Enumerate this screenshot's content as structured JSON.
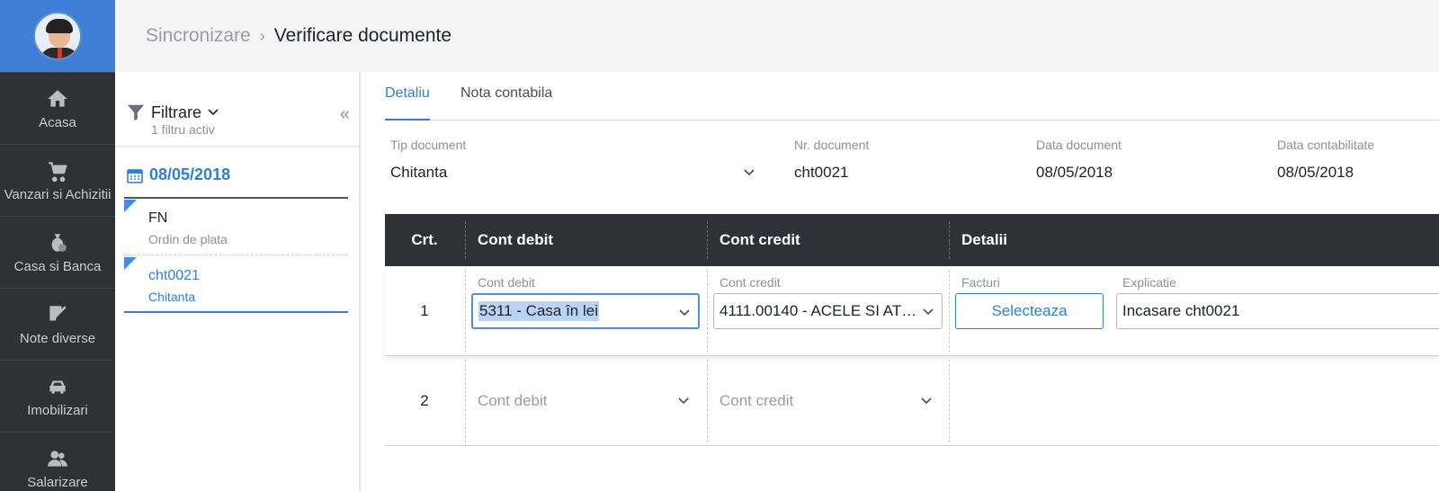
{
  "nav": {
    "items": [
      {
        "label": "Acasa",
        "icon": "home-icon"
      },
      {
        "label": "Vanzari si Achizitii",
        "icon": "cart-icon"
      },
      {
        "label": "Casa si Banca",
        "icon": "money-bag-icon"
      },
      {
        "label": "Note diverse",
        "icon": "note-check-icon"
      },
      {
        "label": "Imobilizari",
        "icon": "car-icon"
      },
      {
        "label": "Salarizare",
        "icon": "people-icon"
      }
    ]
  },
  "header": {
    "crumb_parent": "Sincronizare",
    "crumb_current": "Verificare documente"
  },
  "filter": {
    "title": "Filtrare",
    "subtitle": "1 filtru activ",
    "date": "08/05/2018",
    "documents": [
      {
        "number": "FN",
        "type": "Ordin de plata"
      },
      {
        "number": "cht0021",
        "type": "Chitanta"
      }
    ]
  },
  "tabs": [
    "Detaliu",
    "Nota contabila"
  ],
  "fields": {
    "tip_label": "Tip document",
    "tip_value": "Chitanta",
    "nr_label": "Nr. document",
    "nr_value": "cht0021",
    "data_label": "Data document",
    "data_value": "08/05/2018",
    "contab_label": "Data contabilitate",
    "contab_value": "08/05/2018"
  },
  "table": {
    "headers": [
      "Crt.",
      "Cont debit",
      "Cont credit",
      "Detalii"
    ],
    "rows": [
      {
        "nr": "1",
        "debit_label": "Cont debit",
        "debit_value": "5311 - Casa în lei",
        "credit_label": "Cont credit",
        "credit_value": "4111.00140 - ACELE SI AT…",
        "facturi_label": "Facturi",
        "facturi_button": "Selecteaza",
        "explicatie_label": "Explicatie",
        "explicatie_value": "Incasare cht0021"
      },
      {
        "nr": "2",
        "debit_placeholder": "Cont debit",
        "credit_placeholder": "Cont credit"
      }
    ]
  },
  "colors": {
    "accent": "#2f7de1",
    "nav_bg": "#2f3136",
    "nav_top": "#3f7fd6"
  }
}
